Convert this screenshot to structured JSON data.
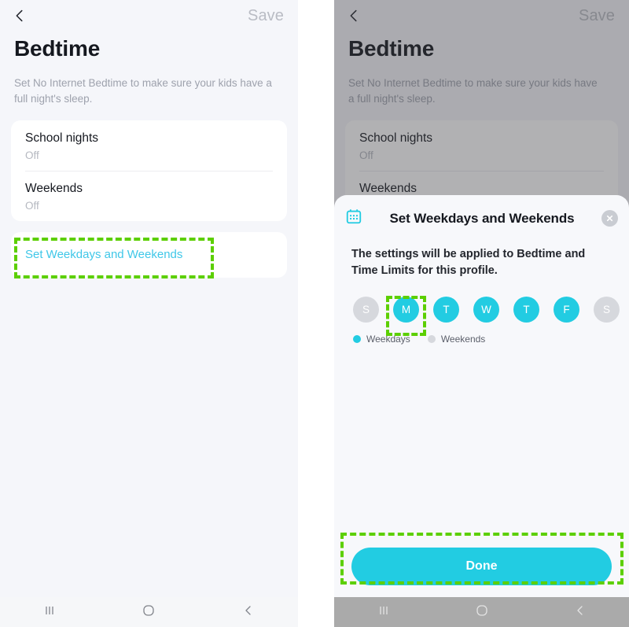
{
  "colors": {
    "accent_cyan": "#22cce2",
    "link_blue": "#3fc7e8",
    "annotation_green": "#5ccf00",
    "background": "#f5f6fa",
    "weekend_grey": "#d6d8dd"
  },
  "screen": {
    "back_icon": "back-chevron-icon",
    "save_label": "Save",
    "title": "Bedtime",
    "description": "Set No Internet Bedtime to make sure your kids have a full night's sleep.",
    "rows": [
      {
        "title": "School nights",
        "value": "Off"
      },
      {
        "title": "Weekends",
        "value": "Off"
      }
    ],
    "link_label": "Set Weekdays and Weekends"
  },
  "dialog": {
    "icon": "calendar-icon",
    "title": "Set Weekdays and Weekends",
    "close_icon": "close-icon",
    "body": "The settings will be applied to Bedtime and Time Limits for this profile.",
    "days": [
      {
        "letter": "S",
        "type": "weekend"
      },
      {
        "letter": "M",
        "type": "weekday"
      },
      {
        "letter": "T",
        "type": "weekday"
      },
      {
        "letter": "W",
        "type": "weekday"
      },
      {
        "letter": "T",
        "type": "weekday"
      },
      {
        "letter": "F",
        "type": "weekday"
      },
      {
        "letter": "S",
        "type": "weekend"
      }
    ],
    "legend": [
      {
        "label": "Weekdays",
        "color": "#22cce2"
      },
      {
        "label": "Weekends",
        "color": "#d6d8dd"
      }
    ],
    "done_label": "Done"
  },
  "navbar": {
    "recents_icon": "recents-icon",
    "home_icon": "home-icon",
    "back_icon": "back-icon"
  }
}
